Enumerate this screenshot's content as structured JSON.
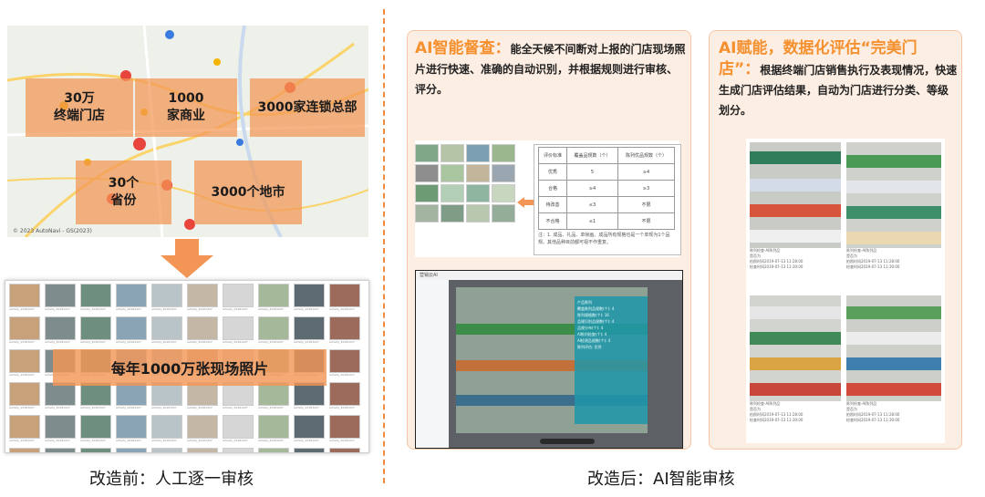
{
  "left": {
    "map": {
      "boxes": [
        {
          "text": "30万\n终端门店"
        },
        {
          "text": "1000\n家商业"
        },
        {
          "text": "3000家连锁总部"
        },
        {
          "text": "30个\n省份"
        },
        {
          "text": "3000个地市"
        }
      ],
      "attribution": "© 2023 AutoNavi - GS(2023)"
    },
    "photos_banner": "每年1000万张现场照片",
    "thumb_caption": "activity_20181227",
    "caption": "改造前：人工逐一审核"
  },
  "right": {
    "card1": {
      "highlight": "AI智能督查：",
      "text": "能全天候不间断对上报的门店现场照片进行快速、准确的自动识别，并根据规则进行审核、评分。",
      "table": [
        [
          "评价标准",
          "覆盖品规数（个）",
          "陈列优品规数（个）"
        ],
        [
          "优秀",
          "5",
          "≥4"
        ],
        [
          "合格",
          "≥4",
          "≥3"
        ],
        [
          "待改善",
          "≤3",
          "不限"
        ],
        [
          "不合格",
          "≤1",
          "不限"
        ]
      ],
      "note": "注：1. 成品、礼品、单帧画、成品所有规格也是一个单规为1个品规。其他品种目前都可视不作重复。",
      "ai_panel": {
        "title": "营销云AI",
        "results": [
          "产品陈列",
          "覆盖陈列品规数(个): 4",
          "陈列规格数(个): 16",
          "品规识别品规数(个): 4",
          "品规分布(个): 4",
          "AI陈列检查(个): 4",
          "AI检测品规数(个): 4",
          "陈列评估: 优秀"
        ]
      }
    },
    "card2": {
      "highlight": "AI赋能，数据化评估“完美门店”：",
      "text": "根据终端门店销售执行及表现情况，快速生成门店评估结果，自动为门店进行分类、等级划分。",
      "photo_labels": [
        [
          "陈列检查-AI陈列品",
          "是否为",
          "拍照时间2019-07-13 11:28:00",
          "检查时间2019-07-13 11:30:00"
        ],
        [
          "陈列检查-AI陈列品",
          "是否为",
          "拍照时间2019-07-13 11:28:00",
          "检查时间2019-07-13 11:30:00"
        ],
        [
          "陈列检查-AI陈列品",
          "是否为",
          "拍照时间2019-07-13 11:28:00",
          "检查时间2019-07-13 11:30:00"
        ],
        [
          "陈列检查-AI陈列品",
          "是否为",
          "拍照时间2019-07-13 11:28:00",
          "检查时间2019-07-13 11:30:00"
        ]
      ]
    },
    "caption": "改造后：AI智能审核"
  },
  "colors": {
    "accent": "#f5902f",
    "box_fill": "#f39655",
    "card_bg": "#fdeee3",
    "divider": "#f08a3c"
  }
}
